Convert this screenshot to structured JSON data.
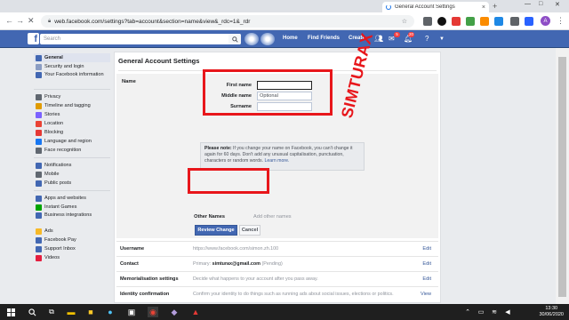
{
  "browser": {
    "tab_title": "General Account Settings",
    "tab_close": "×",
    "new_tab": "+",
    "win_min": "—",
    "win_max": "□",
    "win_close": "✕",
    "url": "web.facebook.com/settings?tab=account&section=name&view&_rdc=1&_rdr",
    "profile_initial": "A"
  },
  "fb": {
    "logo": "f",
    "search_placeholder": "Search",
    "nav": [
      "Home",
      "Find Friends",
      "Create"
    ],
    "badges": {
      "messages": "5",
      "notifications": "20"
    }
  },
  "sidebar": {
    "groups": [
      [
        {
          "label": "General",
          "icon": "gear-icon",
          "active": true
        },
        {
          "label": "Security and login",
          "icon": "shield-icon"
        },
        {
          "label": "Your Facebook information",
          "icon": "facebook-icon"
        }
      ],
      [
        {
          "label": "Privacy",
          "icon": "lock-icon"
        },
        {
          "label": "Timeline and tagging",
          "icon": "timeline-icon"
        },
        {
          "label": "Stories",
          "icon": "stories-icon"
        },
        {
          "label": "Location",
          "icon": "location-icon"
        },
        {
          "label": "Blocking",
          "icon": "blocking-icon"
        },
        {
          "label": "Language and region",
          "icon": "language-icon"
        },
        {
          "label": "Face recognition",
          "icon": "face-icon"
        }
      ],
      [
        {
          "label": "Notifications",
          "icon": "bell-icon"
        },
        {
          "label": "Mobile",
          "icon": "mobile-icon"
        },
        {
          "label": "Public posts",
          "icon": "public-posts-icon"
        }
      ],
      [
        {
          "label": "Apps and websites",
          "icon": "apps-icon"
        },
        {
          "label": "Instant Games",
          "icon": "games-icon"
        },
        {
          "label": "Business integrations",
          "icon": "business-icon"
        },
        {
          "label": "Ads",
          "icon": "ads-icon"
        },
        {
          "label": "Facebook Pay",
          "icon": "pay-icon"
        },
        {
          "label": "Support Inbox",
          "icon": "support-icon"
        },
        {
          "label": "Videos",
          "icon": "videos-icon"
        }
      ]
    ]
  },
  "main": {
    "title": "General Account Settings",
    "name_section": {
      "label": "Name",
      "first_name_label": "First name",
      "first_name_value": "",
      "middle_name_label": "Middle name",
      "middle_name_placeholder": "Optional",
      "surname_label": "Surname",
      "surname_value": "",
      "note_bold": "Please note:",
      "note_text": " If you change your name on Facebook, you can't change it again for 60 days. Don't add any unusual capitalisation, punctuation, characters or random words. ",
      "note_link": "Learn more.",
      "other_names_label": "Other Names",
      "other_names_link": "Add other names",
      "review_button": "Review Change",
      "cancel_button": "Cancel"
    },
    "rows": [
      {
        "label": "Username",
        "value": "https://www.facebook.com/simon.zh.100",
        "action": "Edit"
      },
      {
        "label": "Contact",
        "value_prefix": "Primary: ",
        "value_bold": "simturax@gmail.com",
        "value_suffix": " (Pending)",
        "action": "Edit"
      },
      {
        "label": "Memorialisation settings",
        "value": "Decide what happens to your account after you pass away.",
        "action": "Edit"
      },
      {
        "label": "Identity confirmation",
        "value": "Confirm your identity to do things such as running ads about social issues, elections or politics.",
        "action": "View"
      }
    ]
  },
  "watermark": "SIMTURAX",
  "taskbar": {
    "time": "13:30",
    "date": "30/06/2020"
  },
  "colors": {
    "fb_blue": "#4267b2",
    "highlight_red": "#e8161b",
    "link_blue": "#365899"
  }
}
